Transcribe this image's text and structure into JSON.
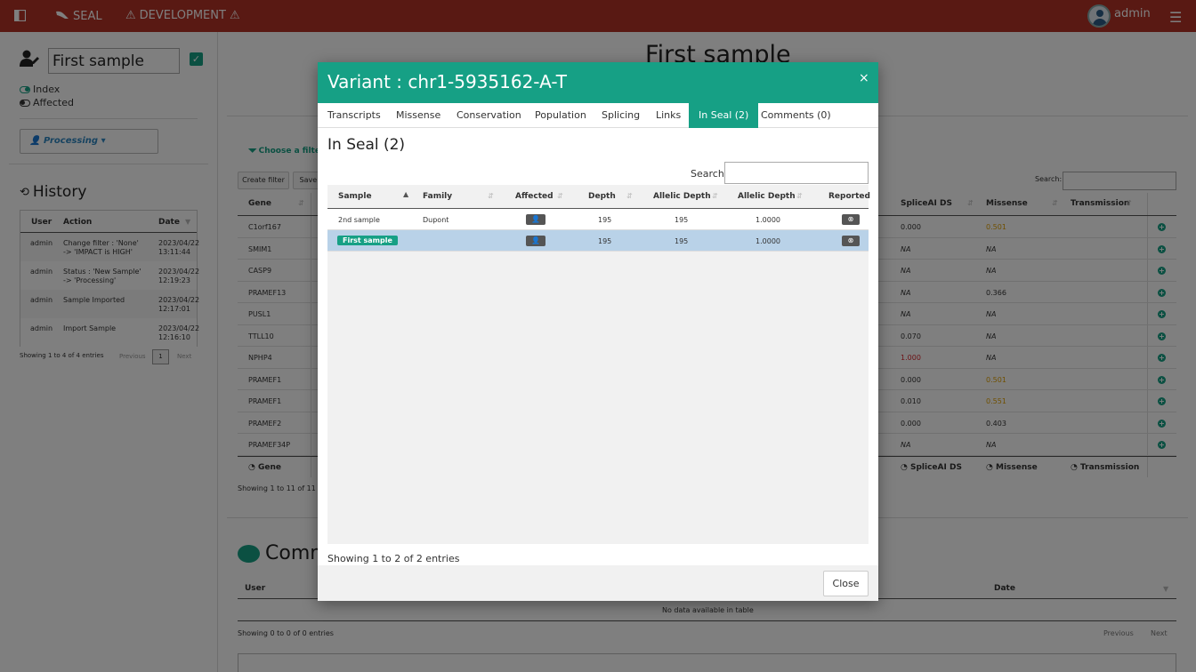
{
  "topbar": {
    "app": "SEAL",
    "env": "DEVELOPMENT",
    "user": "admin"
  },
  "sample": {
    "name": "First sample",
    "index_label": "Index",
    "affected_label": "Affected",
    "status": "Processing"
  },
  "history": {
    "title": "History",
    "headers": [
      "User",
      "Action",
      "Date"
    ],
    "rows": [
      {
        "user": "admin",
        "action": "Change filter : 'None' -> 'IMPACT is HIGH'",
        "date": "2023/04/22 13:11:44"
      },
      {
        "user": "admin",
        "action": "Status : 'New Sample' -> 'Processing'",
        "date": "2023/04/22 12:19:23"
      },
      {
        "user": "admin",
        "action": "Sample Imported",
        "date": "2023/04/22 12:17:01"
      },
      {
        "user": "admin",
        "action": "Import Sample",
        "date": "2023/04/22 12:16:10"
      }
    ],
    "info": "Showing 1 to 4 of 4 entries",
    "prev": "Previous",
    "page": "1",
    "next": "Next"
  },
  "main": {
    "title": "First sample",
    "choose_filter": "Choose a filter",
    "create_filter": "Create filter",
    "save_filter": "Save f",
    "search_label": "Search:",
    "headers": {
      "gene": "Gene",
      "splice": "SpliceAI DS",
      "missense": "Missense",
      "transmission": "Transmission"
    },
    "variants": [
      {
        "gene": "C1orf167",
        "splice": "0.000",
        "missense": "0.501",
        "splice_color": "#333",
        "missense_color": "#e0a000"
      },
      {
        "gene": "SMIM1",
        "splice": "NA",
        "missense": "NA",
        "splice_color": "#333",
        "missense_color": "#333"
      },
      {
        "gene": "CASP9",
        "splice": "NA",
        "missense": "NA",
        "splice_color": "#333",
        "missense_color": "#333"
      },
      {
        "gene": "PRAMEF13",
        "splice": "NA",
        "missense": "0.366",
        "splice_color": "#333",
        "missense_color": "#333"
      },
      {
        "gene": "PUSL1",
        "splice": "NA",
        "missense": "NA",
        "splice_color": "#333",
        "missense_color": "#333"
      },
      {
        "gene": "TTLL10",
        "splice": "0.070",
        "missense": "NA",
        "splice_color": "#333",
        "missense_color": "#333"
      },
      {
        "gene": "NPHP4",
        "splice": "1.000",
        "missense": "NA",
        "splice_color": "#d9262d",
        "missense_color": "#333"
      },
      {
        "gene": "PRAMEF1",
        "splice": "0.000",
        "missense": "0.501",
        "splice_color": "#333",
        "missense_color": "#e0a000"
      },
      {
        "gene": "PRAMEF1",
        "splice": "0.010",
        "missense": "0.551",
        "splice_color": "#333",
        "missense_color": "#e0a000"
      },
      {
        "gene": "PRAMEF2",
        "splice": "0.000",
        "missense": "0.403",
        "splice_color": "#333",
        "missense_color": "#333"
      },
      {
        "gene": "PRAMEF34P",
        "splice": "NA",
        "missense": "NA",
        "splice_color": "#333",
        "missense_color": "#333"
      }
    ],
    "info": "Showing 1 to 11 of 11 e",
    "comments_title": "Comm",
    "comments_headers": {
      "user": "User",
      "date": "Date"
    },
    "comments_empty": "No data available in table",
    "comments_info": "Showing 0 to 0 of 0 entries",
    "comments_prev": "Previous",
    "comments_next": "Next"
  },
  "modal": {
    "title": "Variant : chr1-5935162-A-T",
    "close_x": "×",
    "tabs": [
      "Transcripts",
      "Missense",
      "Conservation",
      "Population",
      "Splicing",
      "Links",
      "In Seal (2)",
      "Comments (0)"
    ],
    "section_title": "In Seal (2)",
    "search_label": "Search:",
    "headers": [
      "Sample",
      "Family",
      "Affected",
      "Depth",
      "Allelic Depth",
      "Allelic Depth",
      "Reported"
    ],
    "rows": [
      {
        "sample": "2nd sample",
        "family": "Dupont",
        "depth": "195",
        "ad": "195",
        "af": "1.0000"
      },
      {
        "sample": "First sample",
        "family": "",
        "depth": "195",
        "ad": "195",
        "af": "1.0000"
      }
    ],
    "info": "Showing 1 to 2 of 2 entries",
    "close_button": "Close"
  },
  "colors": {
    "topbar": "#b23226",
    "accent": "#16a085",
    "selected_row": "#b9d2e8"
  }
}
